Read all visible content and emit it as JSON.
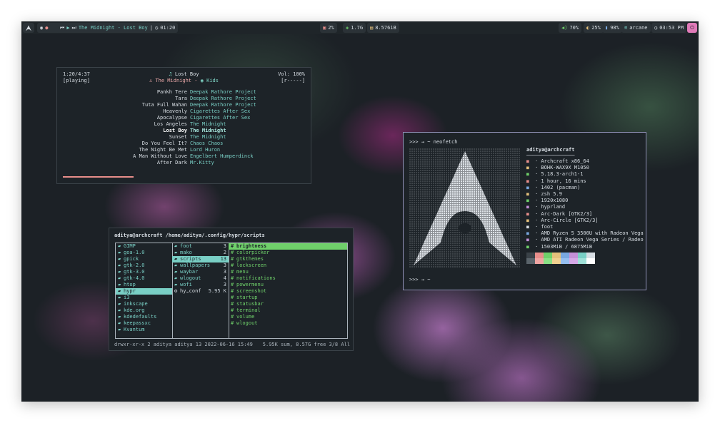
{
  "topbar": {
    "launcher_icon": "arch-icon",
    "media": {
      "controls": [
        "prev-icon",
        "play-icon",
        "next-icon"
      ],
      "track_text": "The Midnight - Lost Boy",
      "time_text": "01:20"
    },
    "stats": [
      {
        "icon": "cpu-icon",
        "value": "2%"
      },
      {
        "icon": "temperature-icon",
        "value": "1.7G"
      },
      {
        "icon": "memory-icon",
        "value": "8.576iB"
      }
    ],
    "right": [
      {
        "icon": "volume-icon",
        "value": "70%"
      },
      {
        "icon": "brightness-icon",
        "value": "25%"
      },
      {
        "icon": "battery-icon",
        "value": "98%"
      },
      {
        "icon": "wifi-icon",
        "value": "arcane"
      },
      {
        "icon": "clock-icon",
        "value": "03:53 PM"
      }
    ]
  },
  "music": {
    "elapsed": "1:20/4:37",
    "state": "[playing]",
    "title": "Lost Boy",
    "artist": "The Midnight",
    "album": "Kids",
    "volume": "Vol: 100%",
    "modes": "[r-----]",
    "progress": 0.29,
    "playlist": [
      {
        "title": "Pankh Tere",
        "artist": "Deepak Rathore Project",
        "current": false
      },
      {
        "title": "Tara",
        "artist": "Deepak Rathore Project",
        "current": false
      },
      {
        "title": "Tuta Full Wahan",
        "artist": "Deepak Rathore Project",
        "current": false
      },
      {
        "title": "Heavenly",
        "artist": "Cigarettes After Sex",
        "current": false
      },
      {
        "title": "Apocalypse",
        "artist": "Cigarettes After Sex",
        "current": false
      },
      {
        "title": "Los Angeles",
        "artist": "The Midnight",
        "current": false
      },
      {
        "title": "Lost Boy",
        "artist": "The Midnight",
        "current": true
      },
      {
        "title": "Sunset",
        "artist": "The Midnight",
        "current": false
      },
      {
        "title": "Do You Feel It?",
        "artist": "Chaos Chaos",
        "current": false
      },
      {
        "title": "The Night Be Met",
        "artist": "Lord Huron",
        "current": false
      },
      {
        "title": "A Man Without Love",
        "artist": "Engelbert Humperdinck",
        "current": false
      },
      {
        "title": "After Dark",
        "artist": "Mr.Kitty",
        "current": false
      }
    ]
  },
  "filemanager": {
    "header": "aditya@archcraft /home/aditya/.config/hypr/scripts",
    "col1": [
      {
        "name": "GIMP",
        "sel": false
      },
      {
        "name": "goa-1.0",
        "sel": false
      },
      {
        "name": "gpick",
        "sel": false
      },
      {
        "name": "gtk-2.0",
        "sel": false
      },
      {
        "name": "gtk-3.0",
        "sel": false
      },
      {
        "name": "gtk-4.0",
        "sel": false
      },
      {
        "name": "htop",
        "sel": false
      },
      {
        "name": "hypr",
        "sel": true
      },
      {
        "name": "i3",
        "sel": false
      },
      {
        "name": "inkscape",
        "sel": false
      },
      {
        "name": "kde.org",
        "sel": false
      },
      {
        "name": "kdedefaults",
        "sel": false
      },
      {
        "name": "keepassxc",
        "sel": false
      },
      {
        "name": "Kvantum",
        "sel": false
      }
    ],
    "col2": [
      {
        "name": "foot",
        "count": "3",
        "sel": false,
        "file": false
      },
      {
        "name": "mako",
        "count": "2",
        "sel": false,
        "file": false
      },
      {
        "name": "scripts",
        "count": "13",
        "sel": true,
        "file": false
      },
      {
        "name": "wallpapers",
        "count": "3",
        "sel": false,
        "file": false
      },
      {
        "name": "waybar",
        "count": "3",
        "sel": false,
        "file": false
      },
      {
        "name": "wlogout",
        "count": "4",
        "sel": false,
        "file": false
      },
      {
        "name": "wofi",
        "count": "3",
        "sel": false,
        "file": false
      },
      {
        "name": "hy…conf",
        "count": "5.95 K",
        "sel": false,
        "file": true
      }
    ],
    "col3": [
      {
        "name": "brightness",
        "sel": true
      },
      {
        "name": "colorpicker",
        "sel": false
      },
      {
        "name": "gtkthemes",
        "sel": false
      },
      {
        "name": "lockscreen",
        "sel": false
      },
      {
        "name": "menu",
        "sel": false
      },
      {
        "name": "notifications",
        "sel": false
      },
      {
        "name": "powermenu",
        "sel": false
      },
      {
        "name": "screenshot",
        "sel": false
      },
      {
        "name": "startup",
        "sel": false
      },
      {
        "name": "statusbar",
        "sel": false
      },
      {
        "name": "terminal",
        "sel": false
      },
      {
        "name": "volume",
        "sel": false
      },
      {
        "name": "wlogout",
        "sel": false
      }
    ],
    "status_left": "drwxr-xr-x 2 aditya aditya 13 2022-06-16 15:49",
    "status_right": "5.95K sum, 8.57G free  3/8  All"
  },
  "neofetch": {
    "prompt_cmd": ">>> → ~ neofetch",
    "prompt_end": ">>> → ~",
    "user": "aditya@archcraft",
    "separator": "────────────────",
    "rows": [
      {
        "icon": "arch-icon",
        "color": "#e88e8b",
        "text": "· Archcraft x86_64"
      },
      {
        "icon": "laptop-icon",
        "color": "#e5c07b",
        "text": "· BOHK-WAX9X M1050"
      },
      {
        "icon": "kernel-icon",
        "color": "#6fd06a",
        "text": "· 5.18.3-arch1-1"
      },
      {
        "icon": "uptime-icon",
        "color": "#e88e8b",
        "text": "· 1 hour, 16 mins"
      },
      {
        "icon": "packages-icon",
        "color": "#79a8e0",
        "text": "· 1402 (pacman)"
      },
      {
        "icon": "shell-icon",
        "color": "#e5c07b",
        "text": "· zsh 5.9"
      },
      {
        "icon": "resolution-icon",
        "color": "#6fd06a",
        "text": "· 1920x1080"
      },
      {
        "icon": "wm-icon",
        "color": "#c490d8",
        "text": "· hyprland"
      },
      {
        "icon": "theme-icon",
        "color": "#e88e8b",
        "text": "· Arc-Dark [GTK2/3]"
      },
      {
        "icon": "icons-icon",
        "color": "#e5c07b",
        "text": "· Arc-Circle [GTK2/3]"
      },
      {
        "icon": "terminal-icon",
        "color": "#d8dee4",
        "text": "· foot"
      },
      {
        "icon": "cpu-icon",
        "color": "#79a8e0",
        "text": "· AMD Ryzen 5 3500U with Radeon Vega"
      },
      {
        "icon": "gpu-icon",
        "color": "#c490d8",
        "text": "· AMD ATI Radeon Vega Series / Radeo"
      },
      {
        "icon": "memory-icon",
        "color": "#6fd06a",
        "text": "· 1503MiB / 6875MiB"
      }
    ],
    "palette": [
      "#3a4248",
      "#e88e8b",
      "#6fd06a",
      "#e5c07b",
      "#79a8e0",
      "#c490d8",
      "#79cfc5",
      "#d8dee4"
    ],
    "palette_bright": [
      "#5a646b",
      "#f0a5a3",
      "#8ae085",
      "#f0d090",
      "#96bff0",
      "#d5a8e6",
      "#a0e0d8",
      "#ffffff"
    ]
  }
}
